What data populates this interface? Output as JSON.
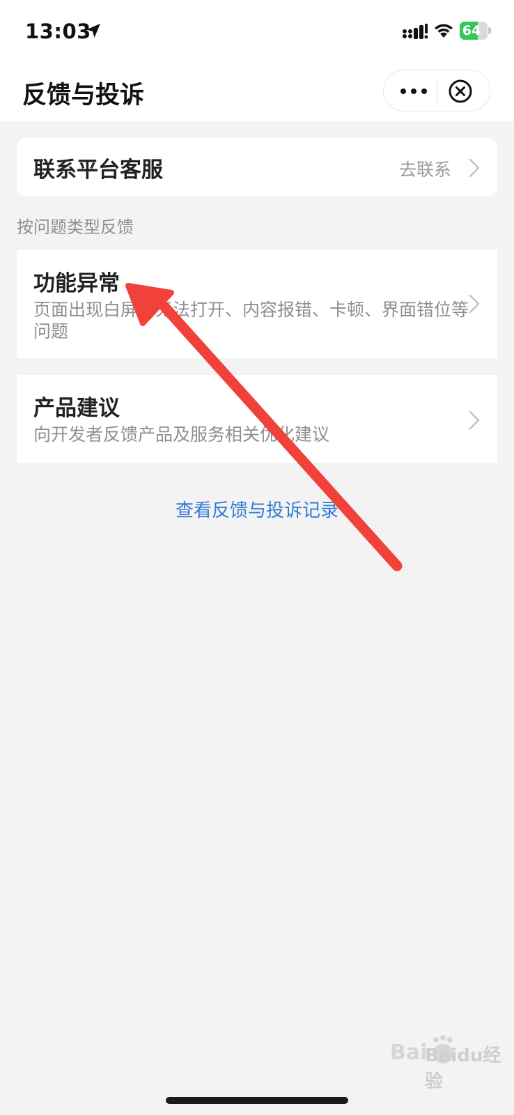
{
  "status_bar": {
    "time": "13:03",
    "battery_level": "64",
    "battery_color": "#34c759"
  },
  "nav": {
    "title": "反馈与投诉",
    "more_icon": "more-dots-icon",
    "close_icon": "close-circle-icon"
  },
  "contact": {
    "title": "联系平台客服",
    "action": "去联系"
  },
  "section_label": "按问题类型反馈",
  "items": [
    {
      "title": "功能异常",
      "desc": "页面出现白屏、无法打开、内容报错、卡顿、界面错位等问题"
    },
    {
      "title": "产品建议",
      "desc": "向开发者反馈产品及服务相关优化建议"
    }
  ],
  "records_link": "查看反馈与投诉记录",
  "link_color": "#2f7bd8",
  "annotation_arrow_color": "#f0413a",
  "watermark": "Baidu经验"
}
